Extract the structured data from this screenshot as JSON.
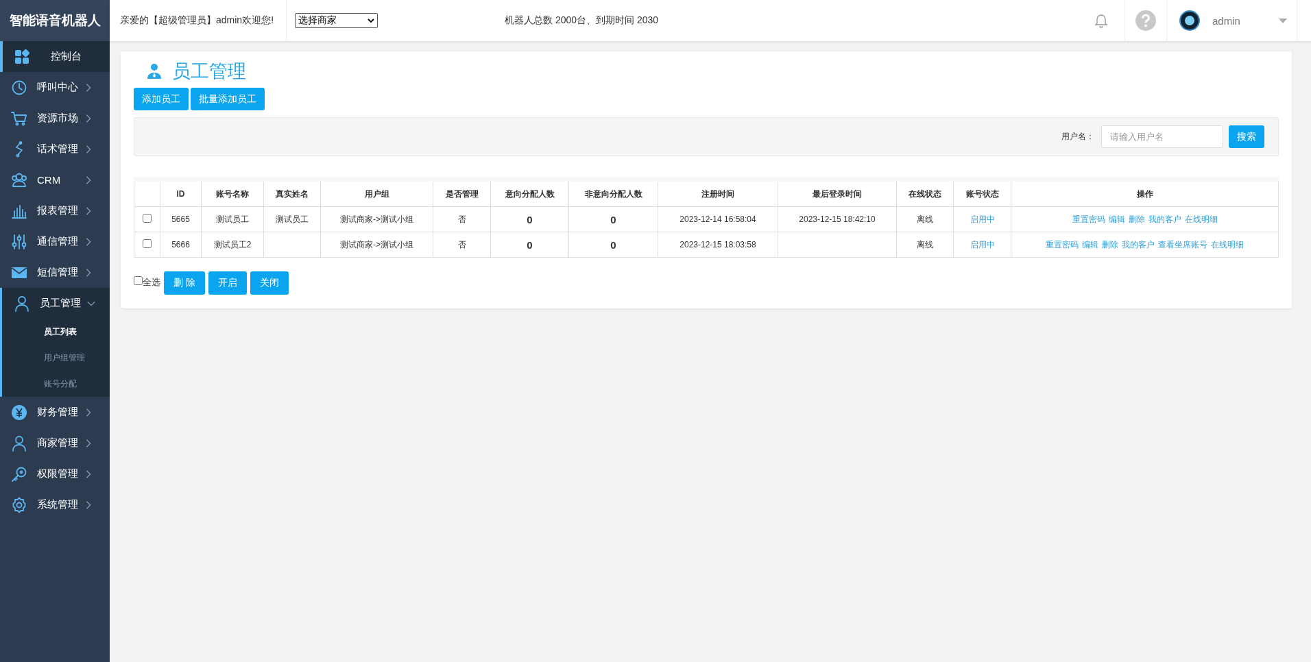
{
  "brand": "智能语音机器人",
  "sidebar": {
    "items": [
      {
        "kind": "link",
        "label": "控制台",
        "selected": true
      },
      {
        "kind": "menu",
        "label": "呼叫中心",
        "expanded": false
      },
      {
        "kind": "menu",
        "label": "资源市场",
        "expanded": false
      },
      {
        "kind": "menu",
        "label": "话术管理",
        "expanded": false
      },
      {
        "kind": "menu",
        "label": "CRM",
        "expanded": false
      },
      {
        "kind": "menu",
        "label": "报表管理",
        "expanded": false
      },
      {
        "kind": "menu",
        "label": "通信管理",
        "expanded": false
      },
      {
        "kind": "menu",
        "label": "短信管理",
        "expanded": false
      },
      {
        "kind": "menu",
        "label": "员工管理",
        "expanded": true,
        "children": [
          {
            "label": "员工列表",
            "selected": true
          },
          {
            "label": "用户组管理",
            "selected": false
          },
          {
            "label": "账号分配",
            "selected": false
          }
        ]
      },
      {
        "kind": "menu",
        "label": "财务管理",
        "expanded": false
      },
      {
        "kind": "menu",
        "label": "商家管理",
        "expanded": false
      },
      {
        "kind": "menu",
        "label": "权限管理",
        "expanded": false
      },
      {
        "kind": "menu",
        "label": "系统管理",
        "expanded": false
      }
    ]
  },
  "header": {
    "greeting": "亲爱的【超级管理员】admin欢迎您!",
    "merchant_select": {
      "value": "选择商家"
    },
    "info": "机器人总数 2000台、到期时间 2030",
    "user": "admin"
  },
  "page": {
    "title": "员工管理",
    "buttons": [
      "添加员工",
      "批量添加员工"
    ],
    "search": {
      "label": "用户名：",
      "placeholder": "请输入用户名",
      "button": "搜索"
    },
    "table": {
      "columns": [
        "ID",
        "账号名称",
        "真实姓名",
        "用户组",
        "是否管理",
        "意向分配人数",
        "非意向分配人数",
        "注册时间",
        "最后登录时间",
        "在线状态",
        "账号状态",
        "操作"
      ],
      "rows": [
        {
          "checked": false,
          "id": "5665",
          "account": "测试员工",
          "real_name": "测试员工",
          "group": "测试商家->测试小组",
          "is_admin": "否",
          "intent_count": "0",
          "non_intent_count": "0",
          "registered": "2023-12-14 16:58:04",
          "last_login": "2023-12-15 18:42:10",
          "online": "离线",
          "account_status": "启用中",
          "actions": [
            "重置密码",
            "编辑",
            "删除",
            "我的客户",
            "在线明细"
          ]
        },
        {
          "checked": false,
          "id": "5666",
          "account": "测试员工2",
          "group": "测试商家->测试小组",
          "is_admin": "否",
          "intent_count": "0",
          "non_intent_count": "0",
          "registered": "2023-12-15 18:03:58",
          "online": "离线",
          "account_status": "启用中",
          "actions": [
            "重置密码",
            "编辑",
            "删除",
            "我的客户",
            "查看坐席账号",
            "在线明细"
          ]
        }
      ]
    },
    "footer": {
      "select_all": {
        "label": "全选",
        "checked": false
      },
      "buttons": [
        "删 除",
        "开启",
        "关闭"
      ]
    }
  }
}
